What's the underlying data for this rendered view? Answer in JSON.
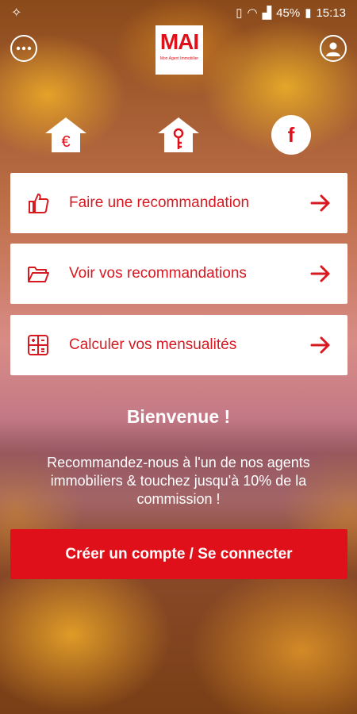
{
  "status_bar": {
    "battery_percent": "45%",
    "time": "15:13",
    "left_icon": "app-notification-icon"
  },
  "header": {
    "menu_icon": "more-horizontal-icon",
    "profile_icon": "user-icon",
    "logo_text": "MAI",
    "logo_subtitle": "Mon Agent Immobilier"
  },
  "quick_icons": [
    {
      "name": "euro-house-icon",
      "symbol": "€"
    },
    {
      "name": "key-house-icon"
    },
    {
      "name": "facebook-icon",
      "symbol": "f"
    }
  ],
  "menu_cards": [
    {
      "label": "Faire une recommandation",
      "icon": "thumbs-up-icon"
    },
    {
      "label": "Voir vos recommandations",
      "icon": "folder-open-icon"
    },
    {
      "label": "Calculer vos mensualités",
      "icon": "calculator-icon"
    }
  ],
  "welcome": {
    "title": "Bienvenue !",
    "text": "Recommandez-nous à l'un de nos agents immobiliers & touchez jusqu'à 10% de la commission !"
  },
  "cta": {
    "label": "Créer un compte / Se connecter"
  },
  "colors": {
    "accent": "#e0101a",
    "card_text": "#d71921"
  }
}
